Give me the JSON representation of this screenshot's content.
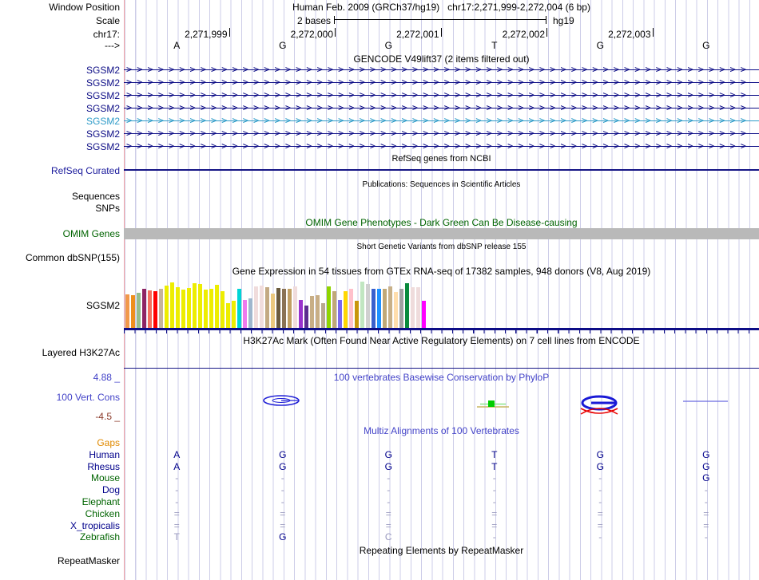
{
  "header": {
    "row_labels": {
      "window_position": "Window Position",
      "scale": "Scale",
      "chrom": "chr17:",
      "direction": "--->"
    },
    "title": "Human Feb. 2009 (GRCh37/hg19)",
    "position": "chr17:2,271,999-2,272,004 (6 bp)",
    "ruler": {
      "label": "2 bases",
      "genome": "hg19"
    },
    "coordinates": [
      "2,271,999",
      "2,272,000",
      "2,272,001",
      "2,272,002",
      "2,272,003"
    ],
    "bases": [
      "A",
      "G",
      "G",
      "T",
      "G",
      "G"
    ]
  },
  "gencode": {
    "title": "GENCODE V49lift37 (2 items filtered out)",
    "genes": [
      {
        "label": "SGSM2",
        "color": "#0D0D86"
      },
      {
        "label": "SGSM2",
        "color": "#0D0D86"
      },
      {
        "label": "SGSM2",
        "color": "#0D0D86"
      },
      {
        "label": "SGSM2",
        "color": "#0D0D86"
      },
      {
        "label": "SGSM2",
        "color": "#2E9BC8"
      },
      {
        "label": "SGSM2",
        "color": "#0D0D86"
      },
      {
        "label": "SGSM2",
        "color": "#0D0D86"
      }
    ]
  },
  "refseq": {
    "label": "RefSeq Curated",
    "center_title": "RefSeq genes from NCBI",
    "color": "#1A1A9C"
  },
  "publications": {
    "title": "Publications: Sequences in Scientific Articles",
    "rows": [
      "Sequences",
      "SNPs"
    ]
  },
  "omim": {
    "label": "OMIM Genes",
    "title": "OMIM Gene Phenotypes - Dark Green Can Be Disease-causing",
    "color": "#006400",
    "bar_color": "#B9B9B9"
  },
  "dbsnp": {
    "label": "Common dbSNP(155)",
    "title": "Short Genetic Variants from dbSNP release 155"
  },
  "gtex": {
    "label": "SGSM2",
    "title": "Gene Expression in 54 tissues from GTEx RNA-seq of 17382 samples, 948 donors (V8, Aug 2019)"
  },
  "h3k27ac": {
    "label": "Layered H3K27Ac",
    "title": "H3K27Ac Mark (Often Found Near Active Regulatory Elements) on 7 cell lines from ENCODE"
  },
  "phylop": {
    "label": "100 Vert. Cons",
    "title": "100 vertebrates Basewise Conservation by PhyloP",
    "max_label": "4.88 _",
    "min_label": "-4.5 _",
    "label_color": "#4343C8",
    "min_color": "#8B3A2A"
  },
  "multiz": {
    "title": "Multiz Alignments of 100 Vertebrates",
    "title_color": "#4343C8",
    "letter_color": "#00008B",
    "dim_color": "#9A9ABF",
    "rows": [
      {
        "name": "Gaps",
        "color": "#E08A00",
        "cells": [
          "",
          "",
          "",
          "",
          "",
          ""
        ],
        "light_cells": []
      },
      {
        "name": "Human",
        "color": "#00008B",
        "cells": [
          "A",
          "G",
          "G",
          "T",
          "G",
          "G"
        ],
        "light_cells": []
      },
      {
        "name": "Rhesus",
        "color": "#00008B",
        "cells": [
          "A",
          "G",
          "G",
          "T",
          "G",
          "G"
        ],
        "light_cells": []
      },
      {
        "name": "Mouse",
        "color": "#006400",
        "cells": [
          "-",
          "-",
          "-",
          "-",
          "-",
          "G"
        ],
        "light_cells": []
      },
      {
        "name": "Dog",
        "color": "#00008B",
        "cells": [
          "-",
          "-",
          "-",
          "-",
          "-",
          "-"
        ],
        "light_cells": []
      },
      {
        "name": "Elephant",
        "color": "#006400",
        "cells": [
          "-",
          "-",
          "-",
          "-",
          "-",
          "-"
        ],
        "light_cells": []
      },
      {
        "name": "Chicken",
        "color": "#006400",
        "cells": [
          "=",
          "=",
          "=",
          "=",
          "=",
          "="
        ],
        "light_cells": []
      },
      {
        "name": "X_tropicalis",
        "color": "#00008B",
        "cells": [
          "=",
          "=",
          "=",
          "=",
          "=",
          "="
        ],
        "light_cells": []
      },
      {
        "name": "Zebrafish",
        "color": "#006400",
        "cells": [
          "T",
          "G",
          "C",
          "-",
          "-",
          "-"
        ],
        "light_cells": [
          0,
          2
        ]
      }
    ]
  },
  "repeatmasker": {
    "label": "RepeatMasker",
    "title": "Repeating Elements by RepeatMasker"
  },
  "chart_data": {
    "type": "bar",
    "title": "Gene Expression in 54 tissues from GTEx RNA-seq of 17382 samples, 948 donors (V8, Aug 2019)",
    "gene": "SGSM2",
    "n_bars": 54,
    "ylim": [
      0,
      60
    ],
    "values": [
      44,
      43,
      46,
      51,
      49,
      48,
      51,
      55,
      59,
      53,
      50,
      52,
      58,
      57,
      50,
      51,
      56,
      48,
      33,
      36,
      51,
      37,
      39,
      54,
      55,
      53,
      45,
      52,
      51,
      51,
      54,
      37,
      30,
      42,
      43,
      33,
      54,
      48,
      37,
      48,
      51,
      36,
      60,
      57,
      51,
      51,
      51,
      54,
      47,
      51,
      58,
      53,
      53,
      36
    ],
    "colors": [
      "#F2984A",
      "#EE8F1E",
      "#96BE8E",
      "#8E2464",
      "#F4705E",
      "#FF0000",
      "#C6B49A",
      "#EDED00",
      "#EDED00",
      "#EDED00",
      "#EDED00",
      "#EDED00",
      "#EDED00",
      "#EDED00",
      "#EDED00",
      "#EDED00",
      "#EDED00",
      "#EDED00",
      "#EDED00",
      "#EDED00",
      "#00D5D5",
      "#EE7AEE",
      "#9FB6CD",
      "#F0DCDC",
      "#F0DCDC",
      "#C3A982",
      "#EBC87E",
      "#6B5B3E",
      "#8B7355",
      "#C19F63",
      "#F0DCDC",
      "#9932CC",
      "#5C2D8E",
      "#C8AE85",
      "#C8AE85",
      "#B8A88F",
      "#8FD400",
      "#C0A878",
      "#7B68EE",
      "#FFD700",
      "#FFC0CB",
      "#C8960C",
      "#C1E6C1",
      "#D0D0D0",
      "#3A5FCD",
      "#1E90FF",
      "#C0A878",
      "#C8B088",
      "#FFDEAD",
      "#A0A0A0",
      "#0A8A3C",
      "#EFDCDC",
      "#EFDCDC",
      "#FF00FF"
    ]
  }
}
